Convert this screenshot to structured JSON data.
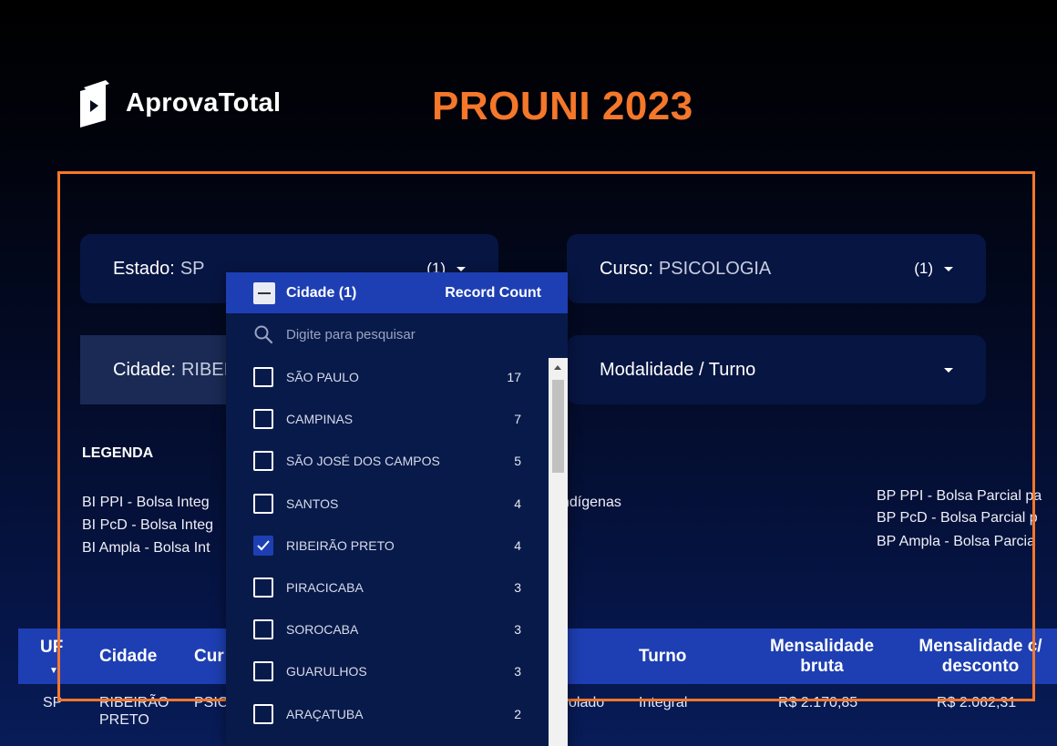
{
  "brand": {
    "logo_text": "AprovaTotal"
  },
  "title": "PROUNI 2023",
  "filters": {
    "estado": {
      "label": "Estado:",
      "value": "SP",
      "count": "(1)"
    },
    "curso": {
      "label": "Curso:",
      "value": "PSICOLOGIA",
      "count": "(1)"
    },
    "cidade": {
      "label": "Cidade:",
      "value": "RIBEIR"
    },
    "modalidade": {
      "label": "Modalidade / Turno"
    }
  },
  "legend": {
    "title": "LEGENDA",
    "lines_left": [
      "BI PPI - Bolsa Integ",
      "BI PcD - Bolsa Integ",
      "BI Ampla - Bolsa Int"
    ],
    "line_mid": "ndígenas",
    "lines_right": [
      "BP PPI - Bolsa Parcial pa",
      "BP PcD - Bolsa Parcial p",
      "BP Ampla - Bolsa Parcia"
    ]
  },
  "table": {
    "headers": {
      "uf": "UF",
      "cidade": "Cidade",
      "curso": "Cur",
      "turno": "Turno",
      "mensalidade_bruta": [
        "Mensalidade",
        "bruta"
      ],
      "mensalidade_desc": [
        "Mensalidade c/",
        "desconto"
      ]
    },
    "row": {
      "uf": "SP",
      "cidade": [
        "RIBEIRÃO",
        "PRETO"
      ],
      "curso": "PSIC",
      "modalidade": "olado",
      "turno": "Integral",
      "bruta": "R$ 2.170,85",
      "desconto": "R$ 2.062,31"
    }
  },
  "dropdown": {
    "header_label": "Cidade (1)",
    "record_count_label": "Record Count",
    "search_placeholder": "Digite para pesquisar",
    "items": [
      {
        "name": "SÃO PAULO",
        "count": "17",
        "checked": false
      },
      {
        "name": "CAMPINAS",
        "count": "7",
        "checked": false
      },
      {
        "name": "SÃO JOSÉ DOS CAMPOS",
        "count": "5",
        "checked": false
      },
      {
        "name": "SANTOS",
        "count": "4",
        "checked": false
      },
      {
        "name": "RIBEIRÃO PRETO",
        "count": "4",
        "checked": true
      },
      {
        "name": "PIRACICABA",
        "count": "3",
        "checked": false
      },
      {
        "name": "SOROCABA",
        "count": "3",
        "checked": false
      },
      {
        "name": "GUARULHOS",
        "count": "3",
        "checked": false
      },
      {
        "name": "ARAÇATUBA",
        "count": "2",
        "checked": false
      }
    ]
  },
  "colors": {
    "accent": "#f4772a",
    "primary": "#1e3fb3",
    "panel": "#071542"
  }
}
